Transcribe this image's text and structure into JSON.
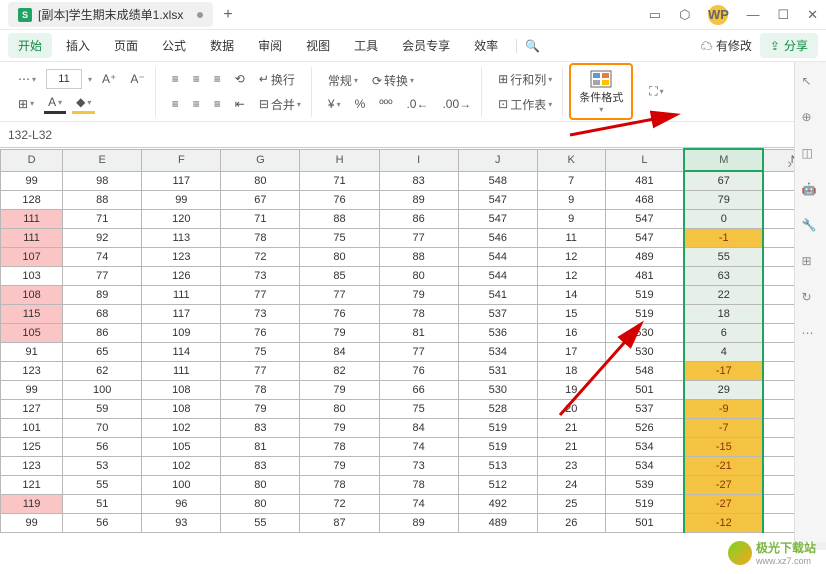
{
  "titlebar": {
    "filename": "[副本]学生期末成绩单1.xlsx"
  },
  "menu": {
    "items": [
      "开始",
      "插入",
      "页面",
      "公式",
      "数据",
      "审阅",
      "视图",
      "工具",
      "会员专享",
      "效率"
    ],
    "changes": "有修改",
    "share": "分享"
  },
  "toolbar": {
    "font_size": "11",
    "format_general": "常规",
    "convert": "转换",
    "rowcol": "行和列",
    "worksheet": "工作表",
    "cond_format": "条件格式",
    "wrap": "换行",
    "merge": "合并"
  },
  "formula": "132-L32",
  "columns": [
    "D",
    "E",
    "F",
    "G",
    "H",
    "I",
    "J",
    "K",
    "L",
    "M",
    "N"
  ],
  "rows": [
    {
      "d": "99",
      "e": "98",
      "f": "117",
      "g": "80",
      "h": "71",
      "i": "83",
      "j": "548",
      "k": "7",
      "l": "481",
      "m": "67",
      "mneg": false
    },
    {
      "d": "128",
      "e": "88",
      "f": "99",
      "g": "67",
      "h": "76",
      "i": "89",
      "j": "547",
      "k": "9",
      "l": "468",
      "m": "79",
      "mneg": false
    },
    {
      "d": "111",
      "dp": true,
      "e": "71",
      "f": "120",
      "g": "71",
      "h": "88",
      "i": "86",
      "j": "547",
      "k": "9",
      "l": "547",
      "m": "0",
      "mneg": false
    },
    {
      "d": "111",
      "dp": true,
      "e": "92",
      "f": "113",
      "g": "78",
      "h": "75",
      "i": "77",
      "j": "546",
      "k": "11",
      "l": "547",
      "m": "-1",
      "mneg": true
    },
    {
      "d": "107",
      "dp": true,
      "e": "74",
      "f": "123",
      "g": "72",
      "h": "80",
      "i": "88",
      "j": "544",
      "k": "12",
      "l": "489",
      "m": "55",
      "mneg": false
    },
    {
      "d": "103",
      "e": "77",
      "f": "126",
      "g": "73",
      "h": "85",
      "i": "80",
      "j": "544",
      "k": "12",
      "l": "481",
      "m": "63",
      "mneg": false
    },
    {
      "d": "108",
      "dp": true,
      "e": "89",
      "f": "111",
      "g": "77",
      "h": "77",
      "i": "79",
      "j": "541",
      "k": "14",
      "l": "519",
      "m": "22",
      "mneg": false
    },
    {
      "d": "115",
      "dp": true,
      "e": "68",
      "f": "117",
      "g": "73",
      "h": "76",
      "i": "78",
      "j": "537",
      "k": "15",
      "l": "519",
      "m": "18",
      "mneg": false
    },
    {
      "d": "105",
      "dp": true,
      "e": "86",
      "f": "109",
      "g": "76",
      "h": "79",
      "i": "81",
      "j": "536",
      "k": "16",
      "l": "530",
      "m": "6",
      "mneg": false
    },
    {
      "d": "91",
      "e": "65",
      "f": "114",
      "g": "75",
      "h": "84",
      "i": "77",
      "j": "534",
      "k": "17",
      "l": "530",
      "m": "4",
      "mneg": false
    },
    {
      "d": "123",
      "e": "62",
      "f": "111",
      "g": "77",
      "h": "82",
      "i": "76",
      "j": "531",
      "k": "18",
      "l": "548",
      "m": "-17",
      "mneg": true
    },
    {
      "d": "99",
      "e": "100",
      "f": "108",
      "g": "78",
      "h": "79",
      "i": "66",
      "j": "530",
      "k": "19",
      "l": "501",
      "m": "29",
      "mneg": false
    },
    {
      "d": "127",
      "e": "59",
      "f": "108",
      "g": "79",
      "h": "80",
      "i": "75",
      "j": "528",
      "k": "20",
      "l": "537",
      "m": "-9",
      "mneg": true
    },
    {
      "d": "101",
      "e": "70",
      "f": "102",
      "g": "83",
      "h": "79",
      "i": "84",
      "j": "519",
      "k": "21",
      "l": "526",
      "m": "-7",
      "mneg": true
    },
    {
      "d": "125",
      "e": "56",
      "f": "105",
      "g": "81",
      "h": "78",
      "i": "74",
      "j": "519",
      "k": "21",
      "l": "534",
      "m": "-15",
      "mneg": true
    },
    {
      "d": "123",
      "e": "53",
      "f": "102",
      "g": "83",
      "h": "79",
      "i": "73",
      "j": "513",
      "k": "23",
      "l": "534",
      "m": "-21",
      "mneg": true
    },
    {
      "d": "121",
      "e": "55",
      "f": "100",
      "g": "80",
      "h": "78",
      "i": "78",
      "j": "512",
      "k": "24",
      "l": "539",
      "m": "-27",
      "mneg": true
    },
    {
      "d": "119",
      "dp": true,
      "e": "51",
      "f": "96",
      "g": "80",
      "h": "72",
      "i": "74",
      "j": "492",
      "k": "25",
      "l": "519",
      "m": "-27",
      "mneg": true
    },
    {
      "d": "99",
      "e": "56",
      "f": "93",
      "g": "55",
      "h": "87",
      "i": "89",
      "j": "489",
      "k": "26",
      "l": "501",
      "m": "-12",
      "mneg": true
    }
  ],
  "watermark": {
    "text": "极光下载站",
    "url": "www.xz7.com"
  }
}
